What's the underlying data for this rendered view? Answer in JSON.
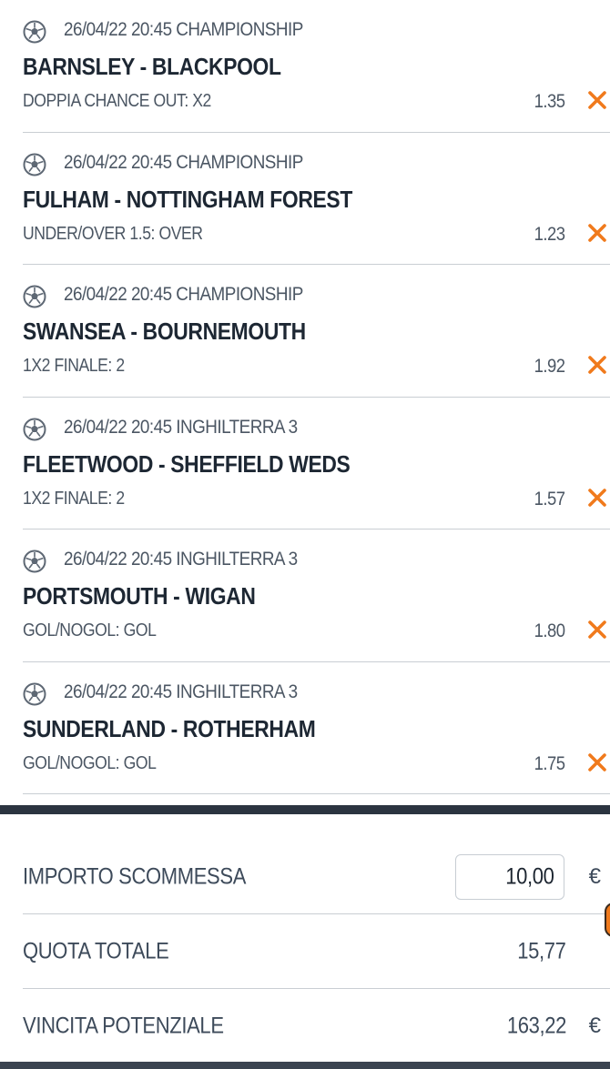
{
  "bets": [
    {
      "meta": "26/04/22 20:45 CHAMPIONSHIP",
      "match": "BARNSLEY - BLACKPOOL",
      "market": "DOPPIA CHANCE OUT: X2",
      "odd": "1.35"
    },
    {
      "meta": "26/04/22 20:45 CHAMPIONSHIP",
      "match": "FULHAM - NOTTINGHAM FOREST",
      "market": "UNDER/OVER 1.5: OVER",
      "odd": "1.23"
    },
    {
      "meta": "26/04/22 20:45 CHAMPIONSHIP",
      "match": "SWANSEA - BOURNEMOUTH",
      "market": "1X2 FINALE: 2",
      "odd": "1.92"
    },
    {
      "meta": "26/04/22 20:45 INGHILTERRA 3",
      "match": "FLEETWOOD - SHEFFIELD WEDS",
      "market": "1X2 FINALE: 2",
      "odd": "1.57"
    },
    {
      "meta": "26/04/22 20:45 INGHILTERRA 3",
      "match": "PORTSMOUTH - WIGAN",
      "market": "GOL/NOGOL: GOL",
      "odd": "1.80"
    },
    {
      "meta": "26/04/22 20:45 INGHILTERRA 3",
      "match": "SUNDERLAND - ROTHERHAM",
      "market": "GOL/NOGOL: GOL",
      "odd": "1.75"
    }
  ],
  "summary": {
    "stake_label": "IMPORTO SCOMMESSA",
    "stake_value": "10,00",
    "stake_currency": "€",
    "total_odds_label": "QUOTA TOTALE",
    "total_odds_value": "15,77",
    "potential_win_label": "VINCITA POTENZIALE",
    "potential_win_value": "163,22",
    "potential_win_currency": "€"
  },
  "icons": {
    "sport": "soccer-ball-icon",
    "remove": "close-x-icon"
  },
  "colors": {
    "accent": "#f07a1c",
    "dark_bar": "#2b3440",
    "text": "#1c2530",
    "muted": "#4b5663"
  }
}
